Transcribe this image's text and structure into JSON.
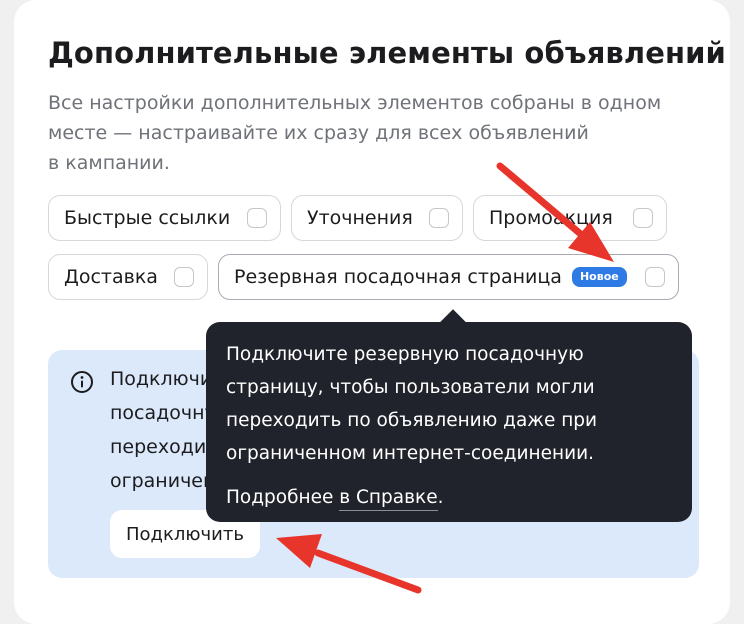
{
  "section": {
    "title": "Дополнительные элементы объявлений",
    "subtitle_lines": [
      "Все настройки дополнительных элементов собраны в одном",
      "месте — настраивайте их сразу для всех объявлений",
      "в кампании."
    ]
  },
  "chips": [
    {
      "label": "Быстрые ссылки",
      "checked": false
    },
    {
      "label": "Уточнения",
      "checked": false
    },
    {
      "label": "Промоакция",
      "checked": false
    },
    {
      "label": "Доставка",
      "checked": false
    },
    {
      "label": "Резервная посадочная страница",
      "badge": "Новое",
      "checked": false
    }
  ],
  "info": {
    "lines": [
      "Подключите резервную",
      "посадочную страницу, чтобы пользователи могли",
      "переходить по объявлению даже при",
      "ограниченном интернет-соединении."
    ],
    "button_label": "Подключить"
  },
  "tooltip": {
    "lines": [
      "Подключите резервную посадочную",
      "страницу, чтобы пользователи могли",
      "переходить по объявлению даже при",
      "ограниченном интернет-соединении."
    ],
    "more_prefix": "Подробнее ",
    "more_link": "в Справке",
    "more_suffix": "."
  },
  "colors": {
    "accent": "#2f7be5",
    "info_bg": "#dce9fb",
    "tooltip_bg": "#20232b",
    "annotation_arrow": "#e8352b"
  },
  "icons": {
    "info": "info-circle-icon",
    "annotation": "red-arrow-icon"
  }
}
